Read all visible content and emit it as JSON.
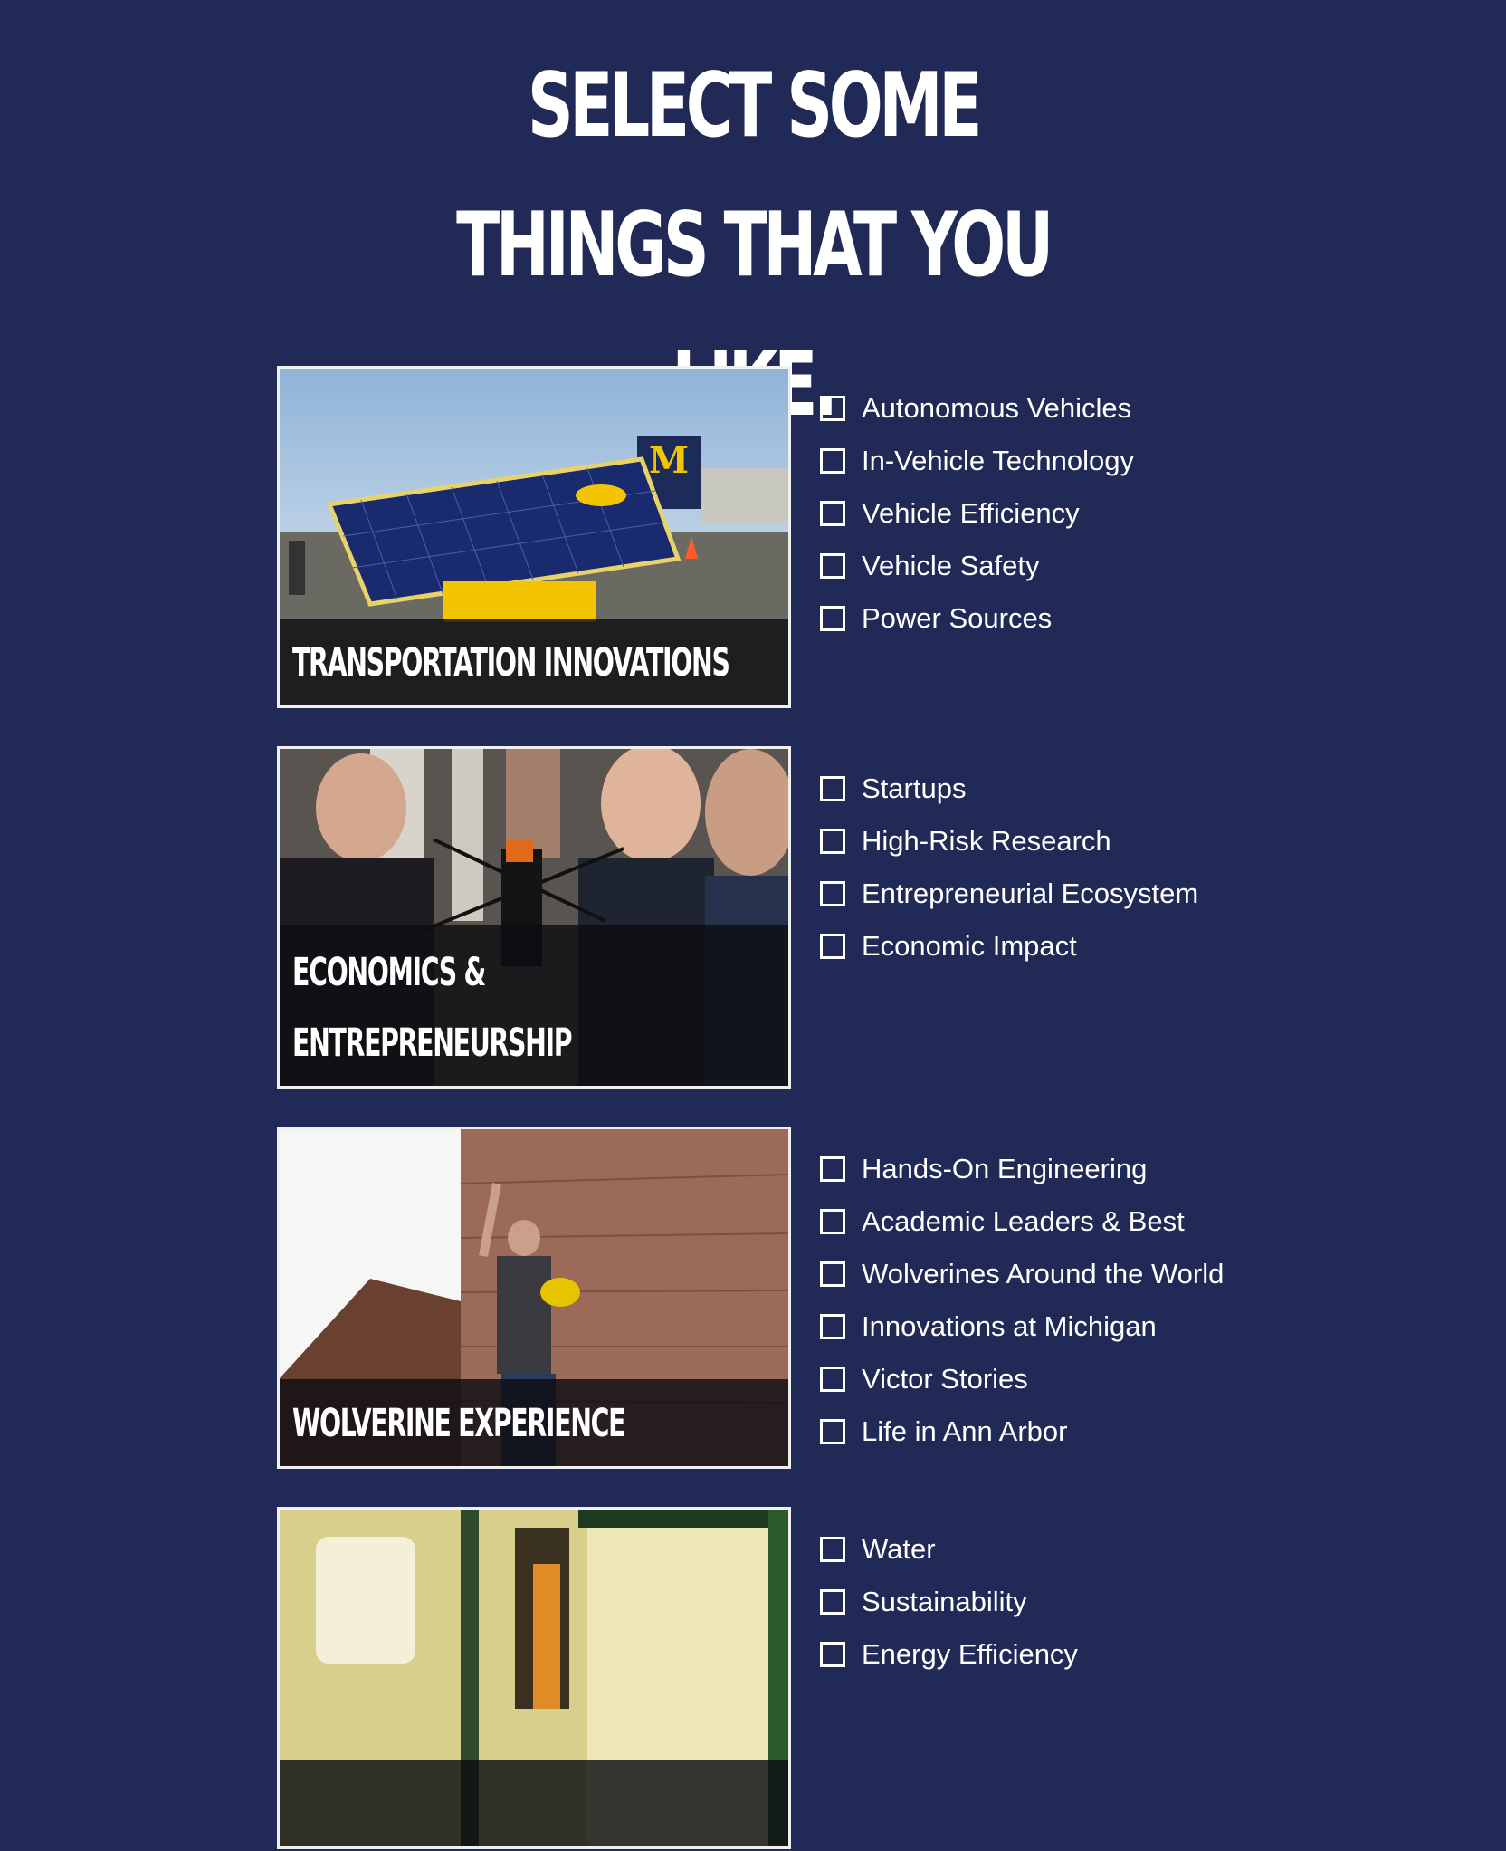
{
  "headline": {
    "line1": "SELECT SOME THINGS THAT YOU",
    "line2": "LIKE."
  },
  "sections": [
    {
      "card_label_line1": "TRANSPORTATION INNOVATIONS",
      "card_label_line2": "",
      "options": [
        "Autonomous Vehicles",
        "In-Vehicle Technology",
        "Vehicle Efficiency",
        "Vehicle Safety",
        "Power Sources"
      ]
    },
    {
      "card_label_line1": "ECONOMICS &",
      "card_label_line2": "ENTREPRENEURSHIP",
      "options": [
        "Startups",
        "High-Risk Research",
        "Entrepreneurial Ecosystem",
        "Economic Impact"
      ]
    },
    {
      "card_label_line1": "WOLVERINE EXPERIENCE",
      "card_label_line2": "",
      "options": [
        "Hands-On Engineering",
        "Academic Leaders & Best",
        "Wolverines Around the World",
        "Innovations at Michigan",
        "Victor Stories",
        "Life in Ann Arbor"
      ]
    },
    {
      "card_label_line1": "",
      "card_label_line2": "",
      "options": [
        "Water",
        "Sustainability",
        "Energy Efficiency"
      ]
    }
  ]
}
